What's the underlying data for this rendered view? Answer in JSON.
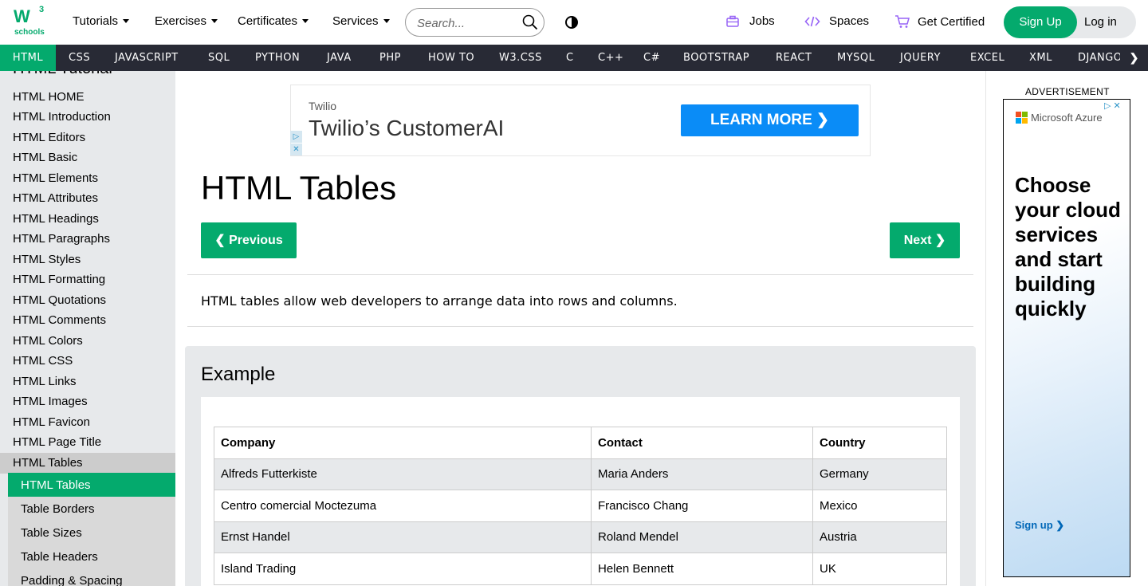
{
  "header": {
    "logo_text": "W",
    "logo_sup": "3",
    "logo_sub": "schools",
    "menus": [
      {
        "label": "Tutorials"
      },
      {
        "label": "Exercises"
      },
      {
        "label": "Certificates"
      },
      {
        "label": "Services"
      }
    ],
    "search_placeholder": "Search...",
    "jobs_label": "Jobs",
    "spaces_label": "Spaces",
    "certified_label": "Get Certified",
    "signup_label": "Sign Up",
    "login_label": "Log in",
    "accent": "#04AA6D",
    "link_icon_color": "#9763f6"
  },
  "subjects": [
    "HTML",
    "CSS",
    "JAVASCRIPT",
    "SQL",
    "PYTHON",
    "JAVA",
    "PHP",
    "HOW TO",
    "W3.CSS",
    "C",
    "C++",
    "C#",
    "BOOTSTRAP",
    "REACT",
    "MYSQL",
    "JQUERY",
    "EXCEL",
    "XML",
    "DJANGO"
  ],
  "sidebar": {
    "title": "HTML Tutorial",
    "items": [
      "HTML HOME",
      "HTML Introduction",
      "HTML Editors",
      "HTML Basic",
      "HTML Elements",
      "HTML Attributes",
      "HTML Headings",
      "HTML Paragraphs",
      "HTML Styles",
      "HTML Formatting",
      "HTML Quotations",
      "HTML Comments",
      "HTML Colors",
      "HTML CSS",
      "HTML Links",
      "HTML Images",
      "HTML Favicon",
      "HTML Page Title",
      "HTML Tables"
    ],
    "subitems": [
      "HTML Tables",
      "Table Borders",
      "Table Sizes",
      "Table Headers",
      "Padding & Spacing"
    ]
  },
  "top_ad": {
    "brand": "Twilio",
    "headline": "Twilio’s CustomerAI",
    "cta": "LEARN MORE"
  },
  "main": {
    "title": "HTML Tables",
    "prev_label": "❮ Previous",
    "next_label": "Next ❯",
    "intro": "HTML tables allow web developers to arrange data into rows and columns.",
    "example_heading": "Example"
  },
  "table": {
    "headers": [
      "Company",
      "Contact",
      "Country"
    ],
    "rows": [
      [
        "Alfreds Futterkiste",
        "Maria Anders",
        "Germany"
      ],
      [
        "Centro comercial Moctezuma",
        "Francisco Chang",
        "Mexico"
      ],
      [
        "Ernst Handel",
        "Roland Mendel",
        "Austria"
      ],
      [
        "Island Trading",
        "Helen Bennett",
        "UK"
      ]
    ]
  },
  "right_ad": {
    "label": "ADVERTISEMENT",
    "brand": "Microsoft Azure",
    "headline": "Choose your cloud services and start building quickly",
    "link": "Sign up ❯"
  }
}
